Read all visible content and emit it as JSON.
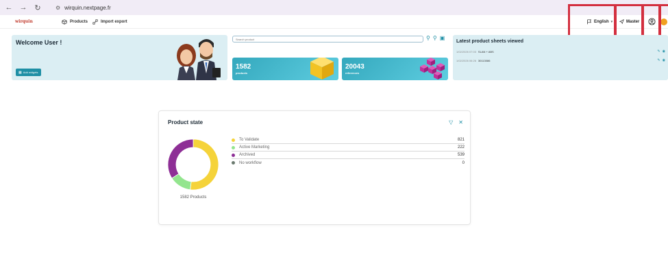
{
  "browser": {
    "url": "wirquin.nextpage.fr"
  },
  "header": {
    "logo": "wirquin",
    "nav": [
      {
        "label": "Products",
        "icon": "cube-icon"
      },
      {
        "label": "Import export",
        "icon": "import-export-icon"
      }
    ],
    "language": "English",
    "mode": "Master"
  },
  "welcome": {
    "title": "Welcome User !",
    "add_widgets_label": "Add widgets"
  },
  "search": {
    "placeholder": "Search product"
  },
  "stats": [
    {
      "value": "1582",
      "label": "products",
      "illustration": "gold-cube"
    },
    {
      "value": "20043",
      "label": "references",
      "illustration": "magenta-cubes"
    }
  ],
  "latest": {
    "title": "Latest product sheets viewed",
    "rows": [
      {
        "date": "1/02/2026 07:03",
        "name": "SLAN + ABS"
      },
      {
        "date": "1/02/2026 06:26",
        "name": "30113086"
      }
    ]
  },
  "product_state": {
    "title": "Product state",
    "caption": "1582 Products",
    "items": [
      {
        "label": "To Validate",
        "count": 821,
        "color": "#f5d33a"
      },
      {
        "label": "Active Marketing",
        "count": 222,
        "color": "#93e58e"
      },
      {
        "label": "Archived",
        "count": 539,
        "color": "#8e2f96"
      },
      {
        "label": "No workflow",
        "count": 0,
        "color": "#6b7a6f"
      }
    ]
  },
  "colors": {
    "accent": "#1f8fa5",
    "card_bg": "#dbeef3",
    "highlight": "#d32f3f"
  }
}
